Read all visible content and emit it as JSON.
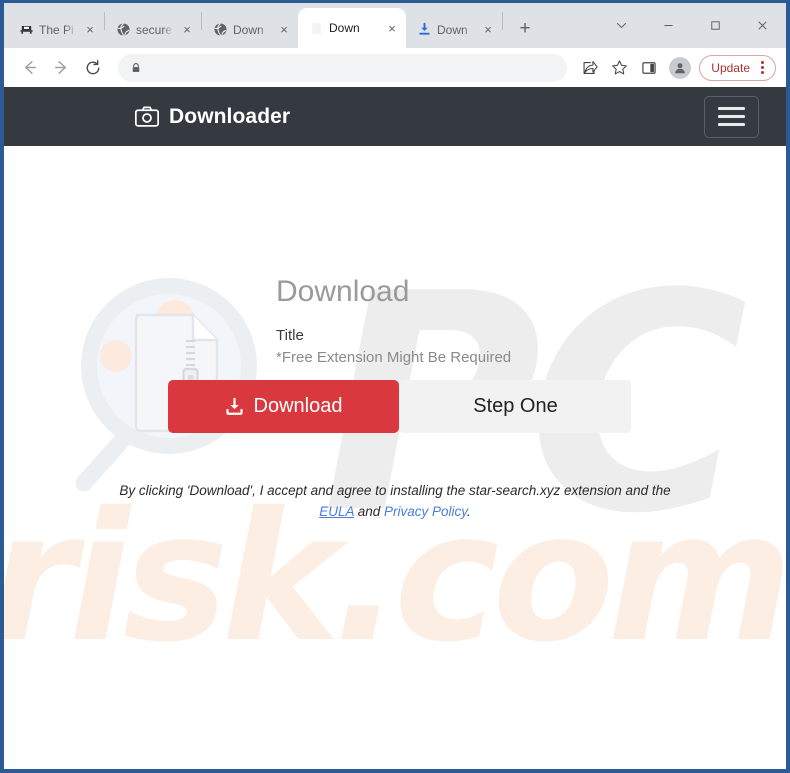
{
  "browser": {
    "tabs": [
      {
        "title": "The Pi",
        "favicon": "ship-icon",
        "active": false,
        "close_label": "×"
      },
      {
        "title": "secure",
        "favicon": "globe-icon",
        "active": false,
        "close_label": "×"
      },
      {
        "title": "Down",
        "favicon": "globe-icon",
        "active": false,
        "close_label": "×"
      },
      {
        "title": "Down",
        "favicon": "page-icon",
        "active": true,
        "close_label": "×"
      },
      {
        "title": "Down",
        "favicon": "download-icon",
        "active": false,
        "close_label": "×"
      }
    ],
    "new_tab_label": "+",
    "window_controls": {
      "tab_search": "tab-search-chevron",
      "minimize": "–",
      "maximize": "□",
      "close": "✕"
    },
    "toolbar": {
      "back": "back-arrow",
      "forward": "forward-arrow",
      "reload": "reload-arrow",
      "omnibox_value": "",
      "omnibox_placeholder": "",
      "lock_icon": "lock-icon",
      "share_icon": "share-icon",
      "bookmark_icon": "star-icon",
      "side_panel_icon": "side-panel-icon",
      "profile_icon": "profile-avatar",
      "update_label": "Update",
      "menu_icon": "kebab-menu-icon"
    }
  },
  "page": {
    "header": {
      "logo_icon": "camera-icon",
      "brand": "Downloader",
      "menu_button": "hamburger-menu"
    },
    "watermarks": {
      "primary": "PC",
      "secondary": "risk.com"
    },
    "illustration": {
      "name": "magnifier-with-zip-file"
    },
    "hero": {
      "title": "Download",
      "subtitle": "Title",
      "note": "*Free Extension Might Be Required"
    },
    "buttons": {
      "download_label": "Download",
      "download_icon": "download-tray-icon",
      "step_label": "Step One"
    },
    "disclaimer": {
      "lead": "By clicking 'Download', I accept and agree to installing the star-search.xyz extension and the",
      "eula": "EULA",
      "conjunction": "and",
      "privacy": "Privacy Policy",
      "period": "."
    },
    "colors": {
      "header_bg": "#343a40",
      "accent_red": "#d9393e",
      "link_blue": "#4a7ddb",
      "watermark_gray": "#ededed",
      "watermark_peach": "#fdeee4",
      "frame_blue": "#2c5a94"
    }
  }
}
